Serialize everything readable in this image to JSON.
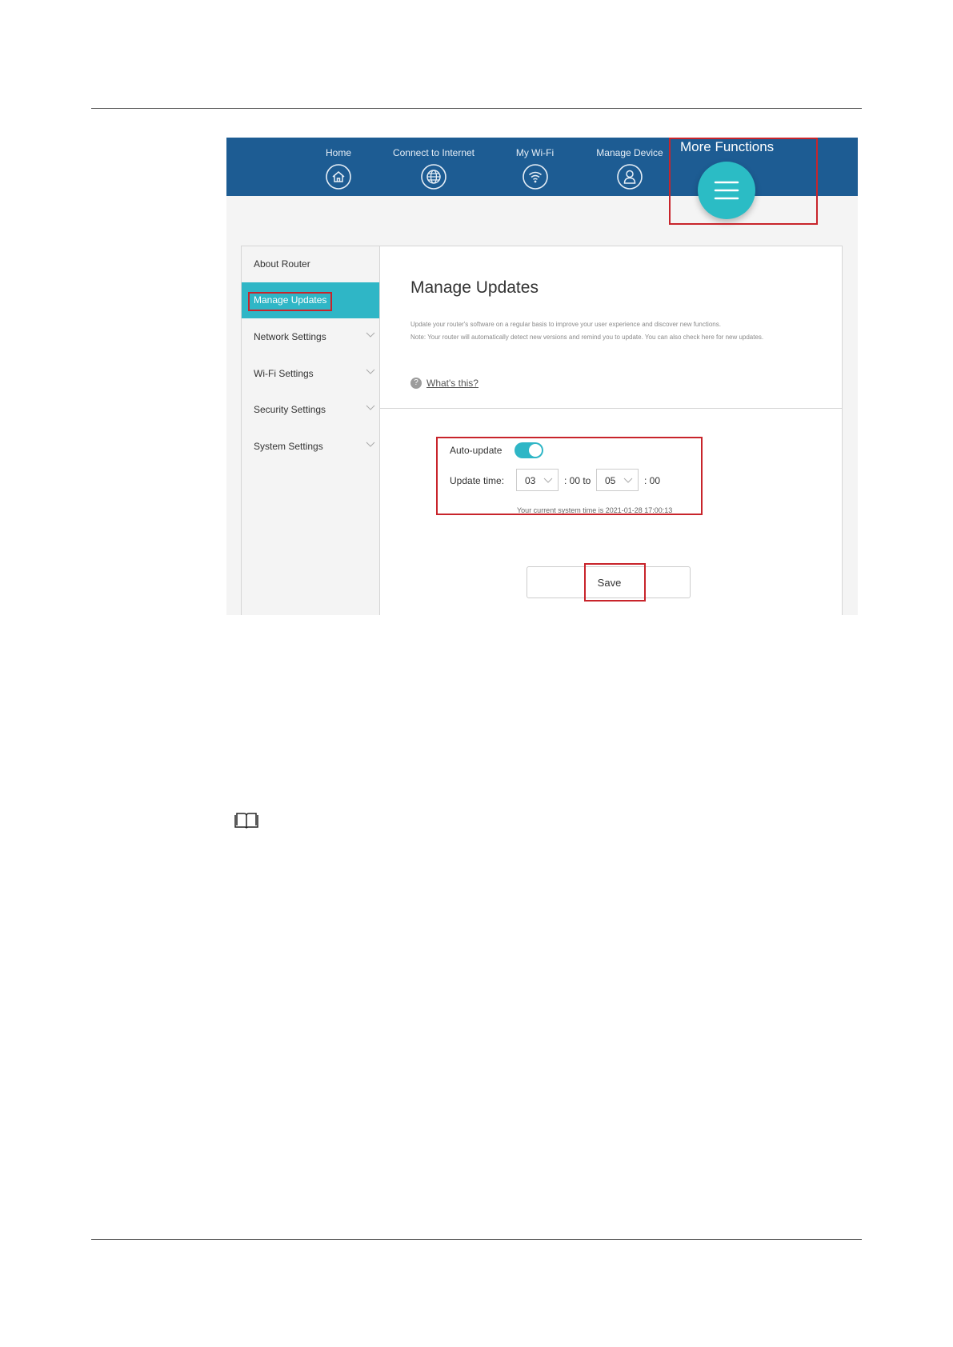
{
  "topbar": {
    "nav": [
      {
        "label": "Home",
        "icon": "home-icon"
      },
      {
        "label": "Connect to Internet",
        "icon": "globe-icon"
      },
      {
        "label": "My Wi-Fi",
        "icon": "wifi-icon"
      },
      {
        "label": "Manage Device",
        "icon": "user-icon"
      }
    ],
    "more_functions": {
      "label": "More Functions",
      "icon": "menu-icon"
    }
  },
  "sidebar": {
    "items": [
      {
        "label": "About Router"
      },
      {
        "label": "Manage Updates"
      },
      {
        "label": "Network Settings"
      },
      {
        "label": "Wi-Fi Settings"
      },
      {
        "label": "Security Settings"
      },
      {
        "label": "System Settings"
      }
    ]
  },
  "main": {
    "title": "Manage Updates",
    "description_line1": "Update your router's software on a regular basis to improve your user experience and discover new functions.",
    "description_line2": "Note: Your router will automatically detect new versions and remind you to update. You can also check here for new updates.",
    "help_link": "What's this?",
    "auto_update_label": "Auto-update",
    "auto_update_on": true,
    "update_time_label": "Update time:",
    "start_hour": "03",
    "start_suffix": ": 00 to",
    "end_hour": "05",
    "end_suffix": ": 00",
    "system_time": "Your current system time is 2021-01-28 17:00:13",
    "save_label": "Save"
  },
  "colors": {
    "topbar": "#1d5c93",
    "accent": "#2fb6c6",
    "highlight_box": "#c8242b"
  },
  "note_icon": "book-icon"
}
